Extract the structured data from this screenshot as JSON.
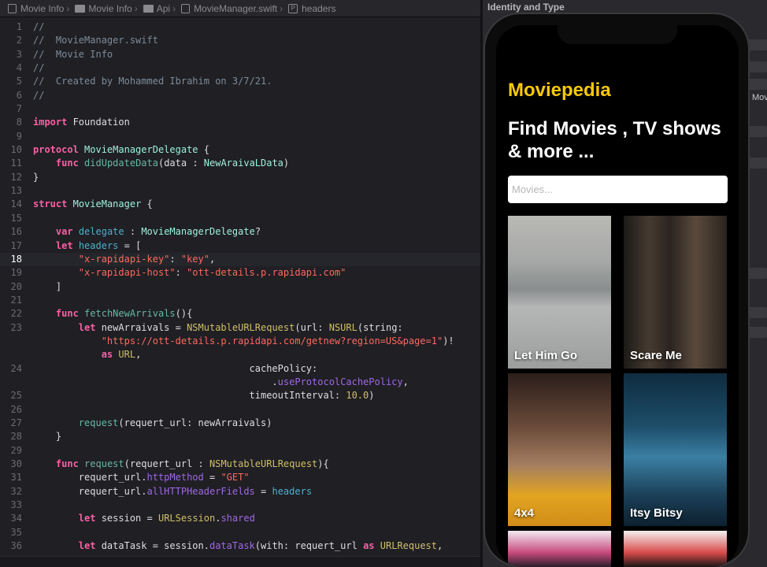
{
  "breadcrumb": [
    "Movie Info",
    "Movie Info",
    "Api",
    "MovieManager.swift",
    "headers"
  ],
  "editor": {
    "current_line": 18,
    "lines": [
      {
        "n": "1",
        "html": "<span class=\"c-com\">//</span>"
      },
      {
        "n": "2",
        "html": "<span class=\"c-com\">//  MovieManager.swift</span>"
      },
      {
        "n": "3",
        "html": "<span class=\"c-com\">//  Movie Info</span>"
      },
      {
        "n": "4",
        "html": "<span class=\"c-com\">//</span>"
      },
      {
        "n": "5",
        "html": "<span class=\"c-com\">//  Created by Mohammed Ibrahim on 3/7/21.</span>"
      },
      {
        "n": "6",
        "html": "<span class=\"c-com\">//</span>"
      },
      {
        "n": "7",
        "html": ""
      },
      {
        "n": "8",
        "html": "<span class=\"c-kw\">import</span> Foundation"
      },
      {
        "n": "9",
        "html": ""
      },
      {
        "n": "10",
        "html": "<span class=\"c-kw\">protocol</span> <span class=\"c-ty\">MovieManagerDelegate</span> {"
      },
      {
        "n": "11",
        "html": "    <span class=\"c-kw\">func</span> <span class=\"c-fn\">didUpdateData</span>(data : <span class=\"c-ty\">NewAraivaLData</span>)"
      },
      {
        "n": "12",
        "html": "}"
      },
      {
        "n": "13",
        "html": ""
      },
      {
        "n": "14",
        "html": "<span class=\"c-kw\">struct</span> <span class=\"c-ty\">MovieManager</span> {"
      },
      {
        "n": "15",
        "html": ""
      },
      {
        "n": "16",
        "html": "    <span class=\"c-kw\">var</span> <span class=\"c-var\">delegate</span> : <span class=\"c-ty\">MovieManagerDelegate</span>?"
      },
      {
        "n": "17",
        "html": "    <span class=\"c-kw\">let</span> <span class=\"c-var\">headers</span> = ["
      },
      {
        "n": "18",
        "html": "        <span class=\"c-str\">\"x-rapidapi-key\"</span>: <span class=\"c-str\">\"key\"</span>,"
      },
      {
        "n": "19",
        "html": "        <span class=\"c-str\">\"x-rapidapi-host\"</span>: <span class=\"c-str\">\"ott-details.p.rapidapi.com\"</span>"
      },
      {
        "n": "20",
        "html": "    ]"
      },
      {
        "n": "21",
        "html": ""
      },
      {
        "n": "22",
        "html": "    <span class=\"c-kw\">func</span> <span class=\"c-fn\">fetchNewArrivals</span>(){"
      },
      {
        "n": "23",
        "html": "        <span class=\"c-kw\">let</span> newArraivals = <span class=\"c-tyi\">NSMutableURLRequest</span>(url: <span class=\"c-tyi\">NSURL</span>(string:"
      },
      {
        "n": "",
        "html": "            <span class=\"c-str\">\"https://ott-details.p.rapidapi.com/getnew?region=US&amp;page=1\"</span>)!"
      },
      {
        "n": "",
        "html": "            <span class=\"c-kw\">as</span> <span class=\"c-tyi\">URL</span>,"
      },
      {
        "n": "24",
        "html": "                                      cachePolicy:"
      },
      {
        "n": "",
        "html": "                                          .<span class=\"c-prop\">useProtocolCachePolicy</span>,"
      },
      {
        "n": "25",
        "html": "                                      timeoutInterval: <span class=\"c-num\">10.0</span>)"
      },
      {
        "n": "26",
        "html": ""
      },
      {
        "n": "27",
        "html": "        <span class=\"c-fn\">request</span>(requert_url: newArraivals)"
      },
      {
        "n": "28",
        "html": "    }"
      },
      {
        "n": "29",
        "html": ""
      },
      {
        "n": "30",
        "html": "    <span class=\"c-kw\">func</span> <span class=\"c-fn\">request</span>(requert_url : <span class=\"c-tyi\">NSMutableURLRequest</span>){"
      },
      {
        "n": "31",
        "html": "        requert_url.<span class=\"c-prop\">httpMethod</span> = <span class=\"c-str\">\"GET\"</span>"
      },
      {
        "n": "32",
        "html": "        requert_url.<span class=\"c-prop\">allHTTPHeaderFields</span> = <span class=\"c-var\">headers</span>"
      },
      {
        "n": "33",
        "html": ""
      },
      {
        "n": "34",
        "html": "        <span class=\"c-kw\">let</span> session = <span class=\"c-tyi\">URLSession</span>.<span class=\"c-prop\">shared</span>"
      },
      {
        "n": "35",
        "html": ""
      },
      {
        "n": "36",
        "html": "        <span class=\"c-kw\">let</span> dataTask = session.<span class=\"c-prop\">dataTask</span>(with: requert_url <span class=\"c-kw\">as</span> <span class=\"c-tyi\">URLRequest</span>,"
      }
    ]
  },
  "inspector": {
    "title": "Identity and Type",
    "partial_text": "Mov"
  },
  "app": {
    "brand": "Moviepedia",
    "headline": "Find Movies , TV shows & more ...",
    "search_placeholder": "Movies...",
    "movies": [
      "Let Him Go",
      "Scare Me",
      "4x4",
      "Itsy Bitsy"
    ]
  },
  "colors": {
    "brand_yellow": "#f7c90c",
    "editor_bg": "#1f1f24",
    "keyword_pink": "#fc5fa3",
    "string_red": "#fc6a5d"
  }
}
